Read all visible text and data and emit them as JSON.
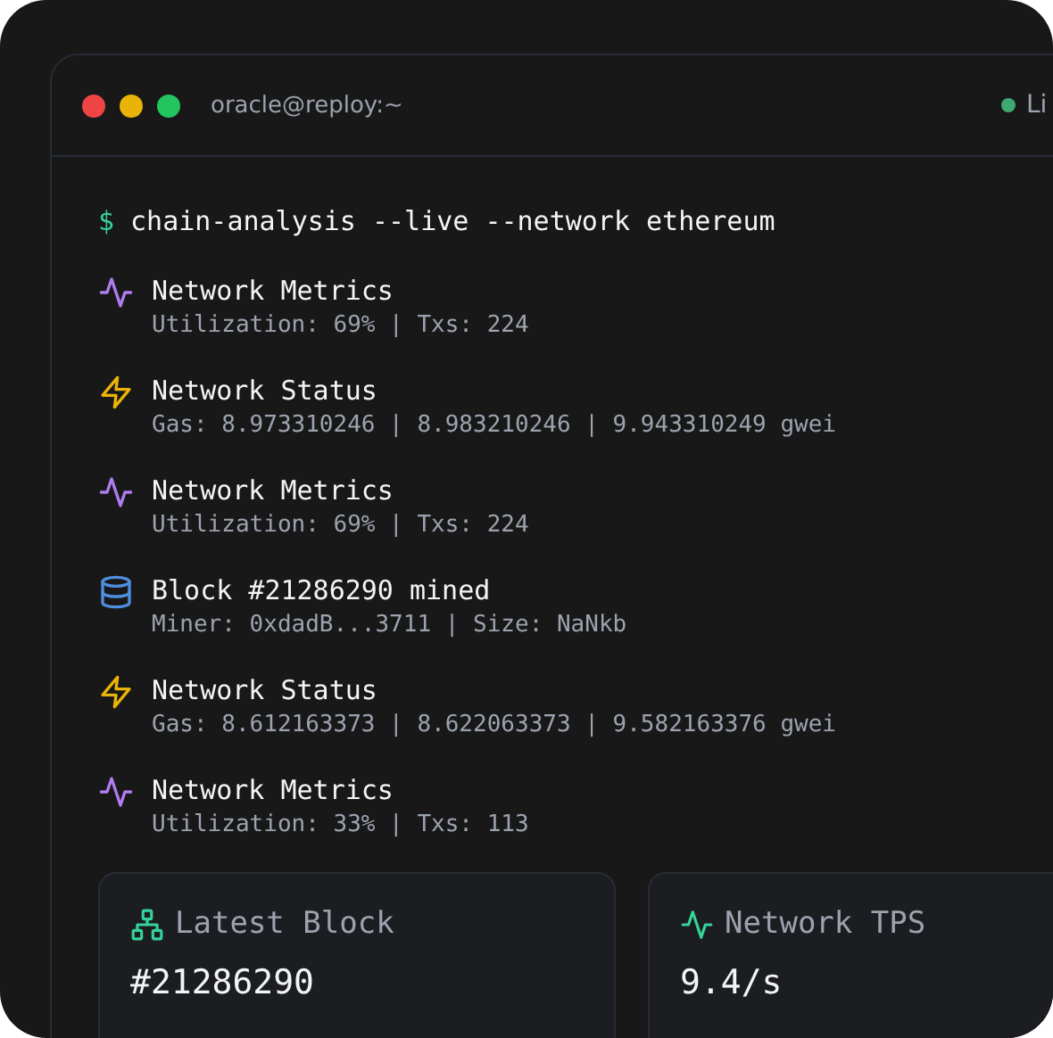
{
  "window": {
    "title": "oracle@reploy:~",
    "status": "Li"
  },
  "command": {
    "prompt": "$",
    "text": "chain-analysis --live --network ethereum"
  },
  "log": [
    {
      "kind": "metrics",
      "title": "Network Metrics",
      "detail": "Utilization: 69% | Txs: 224"
    },
    {
      "kind": "status",
      "title": "Network Status",
      "detail": "Gas: 8.973310246 | 8.983210246 | 9.943310249 gwei"
    },
    {
      "kind": "metrics",
      "title": "Network Metrics",
      "detail": "Utilization: 69% | Txs: 224"
    },
    {
      "kind": "block",
      "title": "Block #21286290 mined",
      "detail": "Miner: 0xdadB...3711 | Size: NaNkb"
    },
    {
      "kind": "status",
      "title": "Network Status",
      "detail": "Gas: 8.612163373 | 8.622063373 | 9.582163376 gwei"
    },
    {
      "kind": "metrics",
      "title": "Network Metrics",
      "detail": "Utilization: 33% | Txs: 113"
    }
  ],
  "cards": [
    {
      "kind": "block",
      "label": "Latest Block",
      "value": "#21286290"
    },
    {
      "kind": "tps",
      "label": "Network TPS",
      "value": "9.4/s"
    }
  ]
}
